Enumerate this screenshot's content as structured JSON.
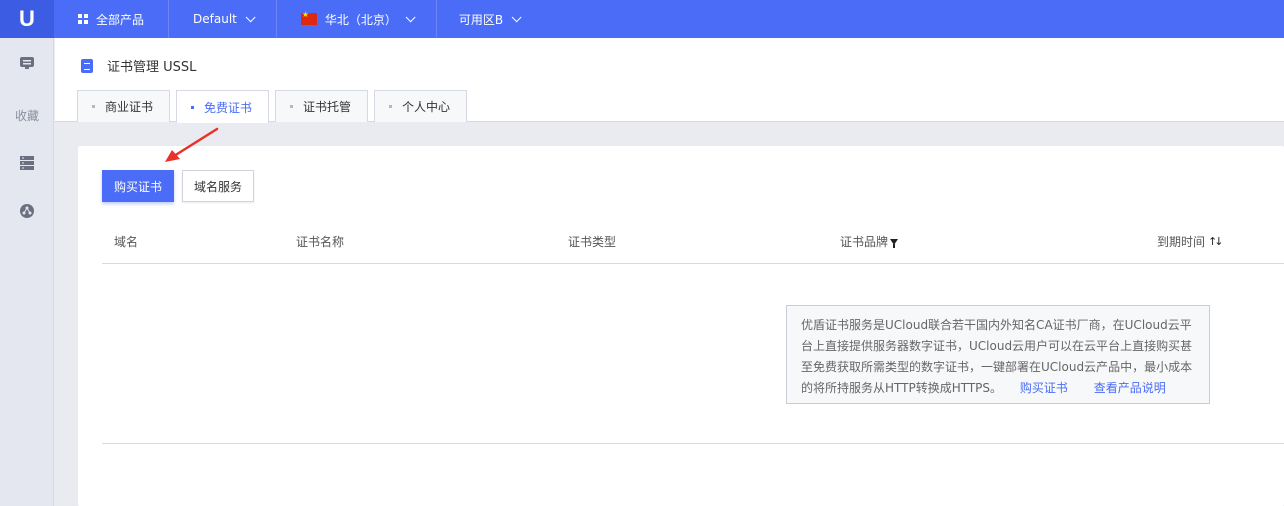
{
  "topbar": {
    "logo": "U",
    "all_products": "全部产品",
    "project": "Default",
    "region": "华北（北京）",
    "zone": "可用区B"
  },
  "sidebar": {
    "favorites_label": "收藏",
    "icons": [
      "monitor-icon",
      "list-icon",
      "network-icon"
    ]
  },
  "header": {
    "title": "证书管理 USSL",
    "tabs": [
      {
        "label": "商业证书",
        "active": false
      },
      {
        "label": "免费证书",
        "active": true
      },
      {
        "label": "证书托管",
        "active": false
      },
      {
        "label": "个人中心",
        "active": false
      }
    ]
  },
  "toolbar": {
    "buy_label": "购买证书",
    "domain_service_label": "域名服务"
  },
  "table": {
    "columns": [
      "域名",
      "证书名称",
      "证书类型",
      "证书品牌",
      "到期时间"
    ]
  },
  "info": {
    "text": "优盾证书服务是UCloud联合若干国内外知名CA证书厂商，在UCloud云平台上直接提供服务器数字证书，UCloud云用户可以在云平台上直接购买甚至免费获取所需类型的数字证书，一键部署在UCloud云产品中，最小成本的将所持服务从HTTP转换成HTTPS。",
    "link_buy": "购买证书",
    "link_docs": "查看产品说明"
  },
  "colors": {
    "brand": "#4a6cf7",
    "annotation_arrow": "#e8312a"
  }
}
